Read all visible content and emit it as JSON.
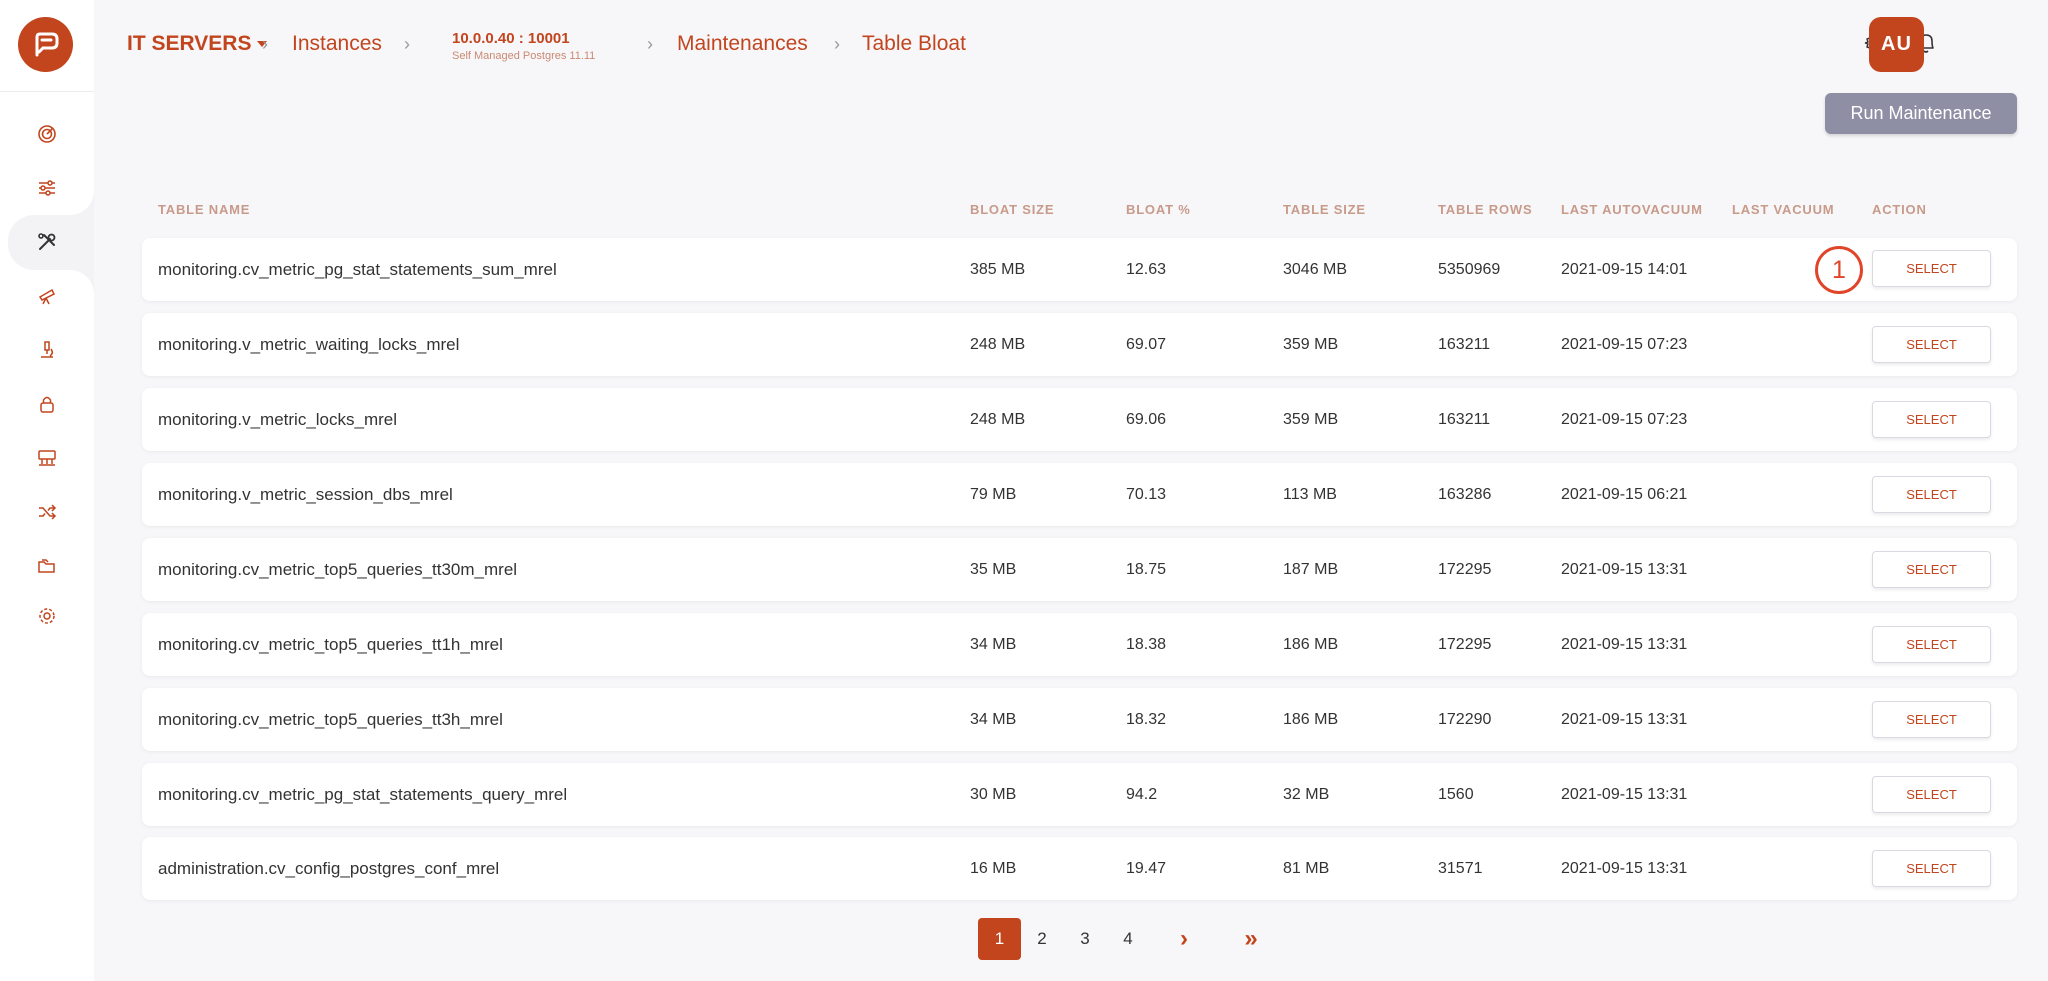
{
  "breadcrumb": {
    "group": "IT SERVERS",
    "instances": "Instances",
    "instance_ip": "10.0.0.40 : 10001",
    "instance_sub": "Self Managed Postgres 11.11",
    "maintenances": "Maintenances",
    "current": "Table Bloat"
  },
  "user": {
    "initials": "AU"
  },
  "actions": {
    "run_maintenance": "Run Maintenance",
    "select_label": "SELECT"
  },
  "annotation": "1",
  "columns": {
    "table_name": "TABLE NAME",
    "bloat_size": "BLOAT SIZE",
    "bloat_pct": "BLOAT %",
    "table_size": "TABLE SIZE",
    "table_rows": "TABLE ROWS",
    "last_autovacuum": "LAST AUTOVACUUM",
    "last_vacuum": "LAST VACUUM",
    "action": "ACTION"
  },
  "rows": [
    {
      "name": "monitoring.cv_metric_pg_stat_statements_sum_mrel",
      "bloat_size": "385 MB",
      "bloat_pct": "12.63",
      "table_size": "3046 MB",
      "table_rows": "5350969",
      "last_autovacuum": "2021-09-15 14:01",
      "last_vacuum": ""
    },
    {
      "name": "monitoring.v_metric_waiting_locks_mrel",
      "bloat_size": "248 MB",
      "bloat_pct": "69.07",
      "table_size": "359 MB",
      "table_rows": "163211",
      "last_autovacuum": "2021-09-15 07:23",
      "last_vacuum": ""
    },
    {
      "name": "monitoring.v_metric_locks_mrel",
      "bloat_size": "248 MB",
      "bloat_pct": "69.06",
      "table_size": "359 MB",
      "table_rows": "163211",
      "last_autovacuum": "2021-09-15 07:23",
      "last_vacuum": ""
    },
    {
      "name": "monitoring.v_metric_session_dbs_mrel",
      "bloat_size": "79 MB",
      "bloat_pct": "70.13",
      "table_size": "113 MB",
      "table_rows": "163286",
      "last_autovacuum": "2021-09-15 06:21",
      "last_vacuum": ""
    },
    {
      "name": "monitoring.cv_metric_top5_queries_tt30m_mrel",
      "bloat_size": "35 MB",
      "bloat_pct": "18.75",
      "table_size": "187 MB",
      "table_rows": "172295",
      "last_autovacuum": "2021-09-15 13:31",
      "last_vacuum": ""
    },
    {
      "name": "monitoring.cv_metric_top5_queries_tt1h_mrel",
      "bloat_size": "34 MB",
      "bloat_pct": "18.38",
      "table_size": "186 MB",
      "table_rows": "172295",
      "last_autovacuum": "2021-09-15 13:31",
      "last_vacuum": ""
    },
    {
      "name": "monitoring.cv_metric_top5_queries_tt3h_mrel",
      "bloat_size": "34 MB",
      "bloat_pct": "18.32",
      "table_size": "186 MB",
      "table_rows": "172290",
      "last_autovacuum": "2021-09-15 13:31",
      "last_vacuum": ""
    },
    {
      "name": "monitoring.cv_metric_pg_stat_statements_query_mrel",
      "bloat_size": "30 MB",
      "bloat_pct": "94.2",
      "table_size": "32 MB",
      "table_rows": "1560",
      "last_autovacuum": "2021-09-15 13:31",
      "last_vacuum": ""
    },
    {
      "name": "administration.cv_config_postgres_conf_mrel",
      "bloat_size": "16 MB",
      "bloat_pct": "19.47",
      "table_size": "81 MB",
      "table_rows": "31571",
      "last_autovacuum": "2021-09-15 13:31",
      "last_vacuum": ""
    }
  ],
  "pagination": {
    "pages": [
      "1",
      "2",
      "3",
      "4"
    ],
    "current": "1",
    "next_icon": "›",
    "last_icon": "»"
  },
  "icons": {
    "sidebar": [
      "dashboard-icon",
      "sliders-icon",
      "tools-icon",
      "telescope-icon",
      "microscope-icon",
      "lock-icon",
      "network-icon",
      "shuffle-icon",
      "folders-icon",
      "settings-icon"
    ],
    "header": [
      "gear-icon",
      "bell-icon"
    ]
  },
  "colors": {
    "accent": "#c2451e",
    "run_button": "#8e8fa4",
    "annotation": "#e0452a"
  }
}
